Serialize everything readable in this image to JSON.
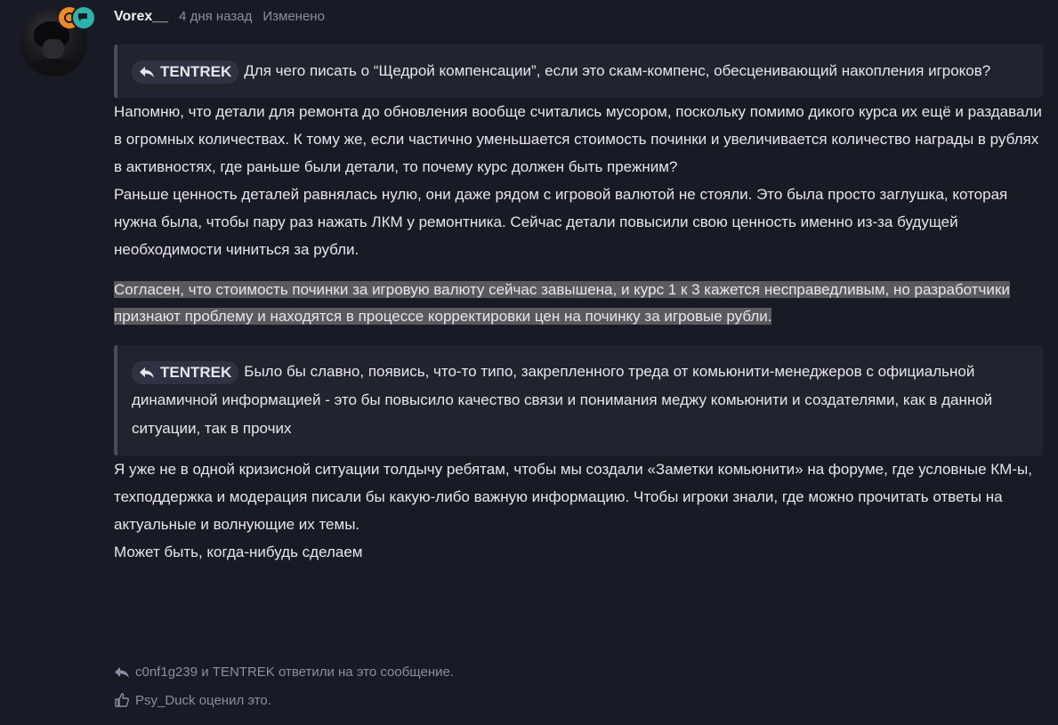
{
  "post": {
    "username": "Vorex__",
    "time": "4 дня назад",
    "edited": "Изменено"
  },
  "quote1": {
    "author": "TENTREK",
    "text": "Для чего писать о “Щедрой компенсации”, если это скам-компенс, обесценивающий накопления игроков?"
  },
  "paragraphs": {
    "p1": "Напомню, что детали для ремонта до обновления вообще считались мусором, поскольку помимо дикого курса их ещё и раздавали в огромных количествах. К тому же, если частично уменьшается стоимость починки и увеличивается количество награды в рублях в активностях, где раньше были детали, то почему курс должен быть прежним?",
    "p2": "Раньше ценность деталей равнялась нулю, они даже рядом с игровой валютой не стояли. Это была просто заглушка, которая нужна была, чтобы пару раз нажать ЛКМ у ремонтника. Сейчас детали повысили свою ценность именно из-за будущей необходимости чиниться за рубли.",
    "highlighted": "Согласен, что стоимость починки за игровую валюту сейчас завышена, и курс 1 к 3 кажется несправедливым, но разработчики признают проблему и находятся в процессе корректировки цен на починку за игровые рубли.",
    "p3": "Я уже не в одной кризисной ситуации толдычу ребятам, чтобы мы создали «Заметки комьюнити» на форуме, где условные КМ-ы, техподдержка и модерация писали бы какую-либо важную информацию. Чтобы игроки знали, где можно прочитать ответы на актуальные и волнующие их темы.",
    "p4": "Может быть, когда-нибудь сделаем"
  },
  "quote2": {
    "author": "TENTREK",
    "text": "Было бы славно, появись, что-то типо, закрепленного треда от комьюнити-менеджеров с официальной динамичной информацией - это бы повысило качество связи и понимания меджу комьюнити и создателями, как в данной ситуации, так в прочих"
  },
  "footer": {
    "replies": "c0nf1g239 и TENTREK ответили на это сообщение.",
    "likes": "Psy_Duck оценил это."
  },
  "icons": {
    "reply": "reply-icon",
    "like": "thumbs-up-icon"
  },
  "colors": {
    "background": "#181a25",
    "quote_bg": "#21232f",
    "highlight": "#5a5a5e",
    "badge_orange": "#f08a24",
    "badge_teal": "#2fb3a8"
  }
}
